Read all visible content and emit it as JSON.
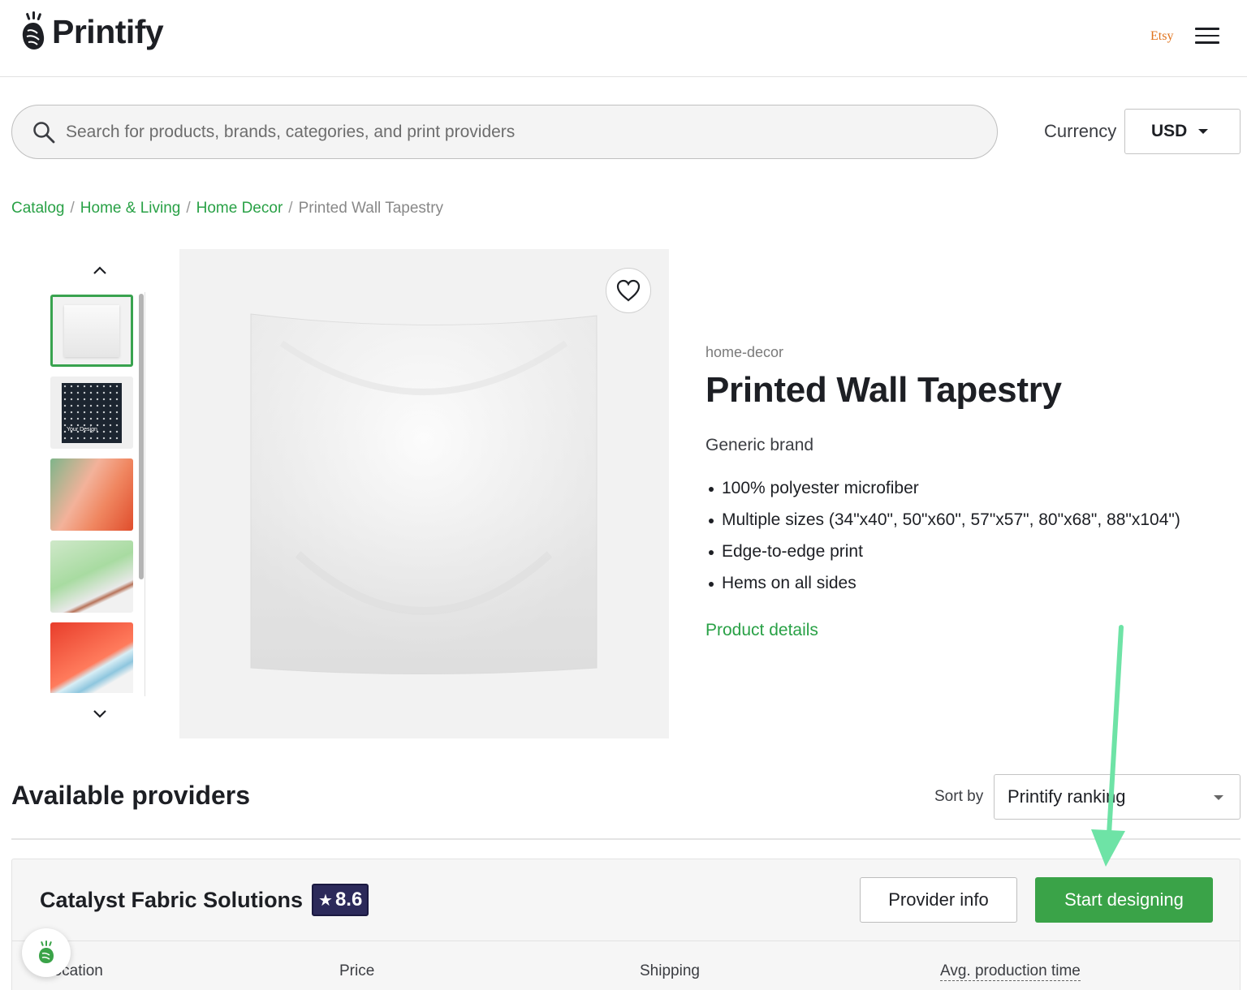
{
  "header": {
    "logo_text": "Printify",
    "etsy_label": "Etsy",
    "menu_icon": "hamburger-menu-icon"
  },
  "search": {
    "placeholder": "Search for products, brands, categories, and print providers",
    "value": ""
  },
  "currency": {
    "label": "Currency",
    "selected": "USD"
  },
  "breadcrumb": [
    {
      "label": "Catalog",
      "link": true
    },
    {
      "label": "Home & Living",
      "link": true
    },
    {
      "label": "Home Decor",
      "link": true
    },
    {
      "label": "Printed Wall Tapestry",
      "link": false
    }
  ],
  "thumbnails": {
    "dark_thumb_text": "Your Design"
  },
  "product": {
    "category": "home-decor",
    "title": "Printed Wall Tapestry",
    "brand": "Generic brand",
    "features": [
      "100% polyester microfiber",
      "Multiple sizes (34\"x40\", 50\"x60\", 57\"x57\", 80\"x68\", 88\"x104\")",
      "Edge-to-edge print",
      "Hems on all sides"
    ],
    "details_link": "Product details"
  },
  "providers": {
    "title": "Available providers",
    "sort_label": "Sort by",
    "sort_selected": "Printify ranking",
    "card": {
      "name": "Catalyst Fabric Solutions",
      "rating": "8.6",
      "provider_info_label": "Provider info",
      "start_designing_label": "Start designing",
      "columns": [
        "Location",
        "Price",
        "Shipping",
        "Avg. production time"
      ]
    }
  },
  "colors": {
    "brand_green": "#29a146",
    "button_green": "#3aa348",
    "rating_badge": "#2c2a5a",
    "annotation_arrow": "#6ee3a6"
  }
}
